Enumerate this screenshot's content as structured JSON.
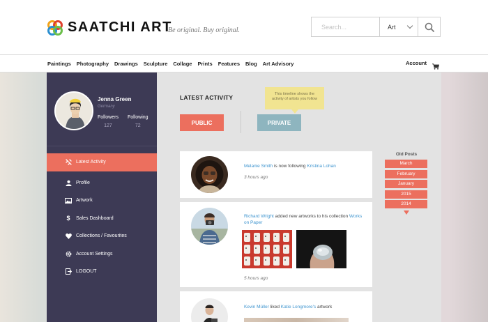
{
  "header": {
    "logo_text": "SAATCHI ART",
    "tagline": "Be original. Buy original.",
    "search": {
      "placeholder": "Search...",
      "category": "Art"
    }
  },
  "nav": {
    "links": [
      "Paintings",
      "Photography",
      "Drawings",
      "Sculpture",
      "Collage",
      "Prints",
      "Features",
      "Blog",
      "Art Advisory"
    ],
    "account": "Account"
  },
  "profile": {
    "name": "Jenna Green",
    "location": "Germany",
    "followers_label": "Followers",
    "followers_count": "127",
    "following_label": "Following",
    "following_count": "72"
  },
  "sidebar": {
    "items": [
      {
        "label": "Latest Activity",
        "icon": "activity-icon",
        "active": true
      },
      {
        "label": "Profile",
        "icon": "user-icon"
      },
      {
        "label": "Artwork",
        "icon": "image-icon"
      },
      {
        "label": "Sales Dashboard",
        "icon": "dollar-icon"
      },
      {
        "label": "Collections / Favourites",
        "icon": "heart-icon"
      },
      {
        "label": "Account Settings",
        "icon": "gear-icon"
      },
      {
        "label": "LOGOUT",
        "icon": "logout-icon"
      }
    ]
  },
  "main": {
    "title": "LATEST ACTIVITY",
    "tooltip": "This timeline shows the activity of artists you follow",
    "public_label": "PUBLIC",
    "private_label": "PRIVATE",
    "activities": [
      {
        "actor": "Melanie Smith",
        "action": " is now following ",
        "target": "Kristina Lohan",
        "time": "3 hours ago"
      },
      {
        "actor": "Richard Wright",
        "action": " added new artworks to his collection ",
        "target": "Works on Paper",
        "time": "5 hours ago"
      },
      {
        "actor": "Kevin Müller",
        "action": " liked ",
        "target": "Katie Longmore's",
        "suffix": " artwork"
      }
    ]
  },
  "old_posts": {
    "title": "Old Posts",
    "items": [
      "March",
      "February",
      "January",
      "2015",
      "2014"
    ]
  },
  "colors": {
    "accent": "#ec6f5e",
    "sidebar": "#3d3a55",
    "private": "#8eb5bf",
    "link": "#3f95cf",
    "tooltip": "#f1e491"
  }
}
